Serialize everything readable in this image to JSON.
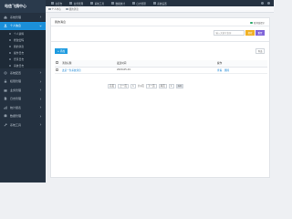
{
  "sidebar": {
    "brand": "电信飞鸽中心",
    "items": [
      {
        "label": "系统管理",
        "icon": "home-icon"
      },
      {
        "label": "个人信息",
        "icon": "user-icon",
        "active": true,
        "children": [
          "个人资料",
          "修改密码",
          "我的消息",
          "操作日志",
          "登录日志",
          "系统日志"
        ]
      },
      {
        "label": "系统配置",
        "icon": "gear-icon"
      },
      {
        "label": "权限管理",
        "icon": "lock-icon"
      },
      {
        "label": "业务管理",
        "icon": "briefcase-icon"
      },
      {
        "label": "日志管理",
        "icon": "file-icon"
      },
      {
        "label": "统计报表",
        "icon": "chart-icon"
      },
      {
        "label": "数据管理",
        "icon": "database-icon"
      },
      {
        "label": "系统工具",
        "icon": "wrench-icon"
      }
    ]
  },
  "topbar": {
    "tabs": [
      "主控台",
      "业务管理",
      "系统工具",
      "数据统计",
      "日志管理",
      "系统设置"
    ]
  },
  "breadcrumbs": [
    "个人中心",
    "我的消息"
  ],
  "panel": {
    "title": "我的消息",
    "badge": "新消息提示",
    "search_placeholder": "输入关键字查询",
    "search_label": "搜索",
    "reset_label": "重置",
    "add_label": "+ 添加",
    "export_label": "导出"
  },
  "table": {
    "headers": [
      "",
      "消息标题",
      "发送时间",
      "操作"
    ],
    "rows": [
      {
        "title": "这是一条系统消息",
        "time": "2020-05-01",
        "actions": [
          "查看",
          "删除"
        ]
      }
    ]
  },
  "pager": {
    "first": "首页",
    "prev": "上一页",
    "current": "1",
    "total_label": "共1页",
    "next": "下一页",
    "last": "尾页",
    "jump_value": "1",
    "go": "GO"
  },
  "colors": {
    "sidebar_bg": "#243140",
    "accent": "#1b8fd9",
    "search_btn": "#f0b023",
    "reset_btn": "#7f63d8"
  }
}
